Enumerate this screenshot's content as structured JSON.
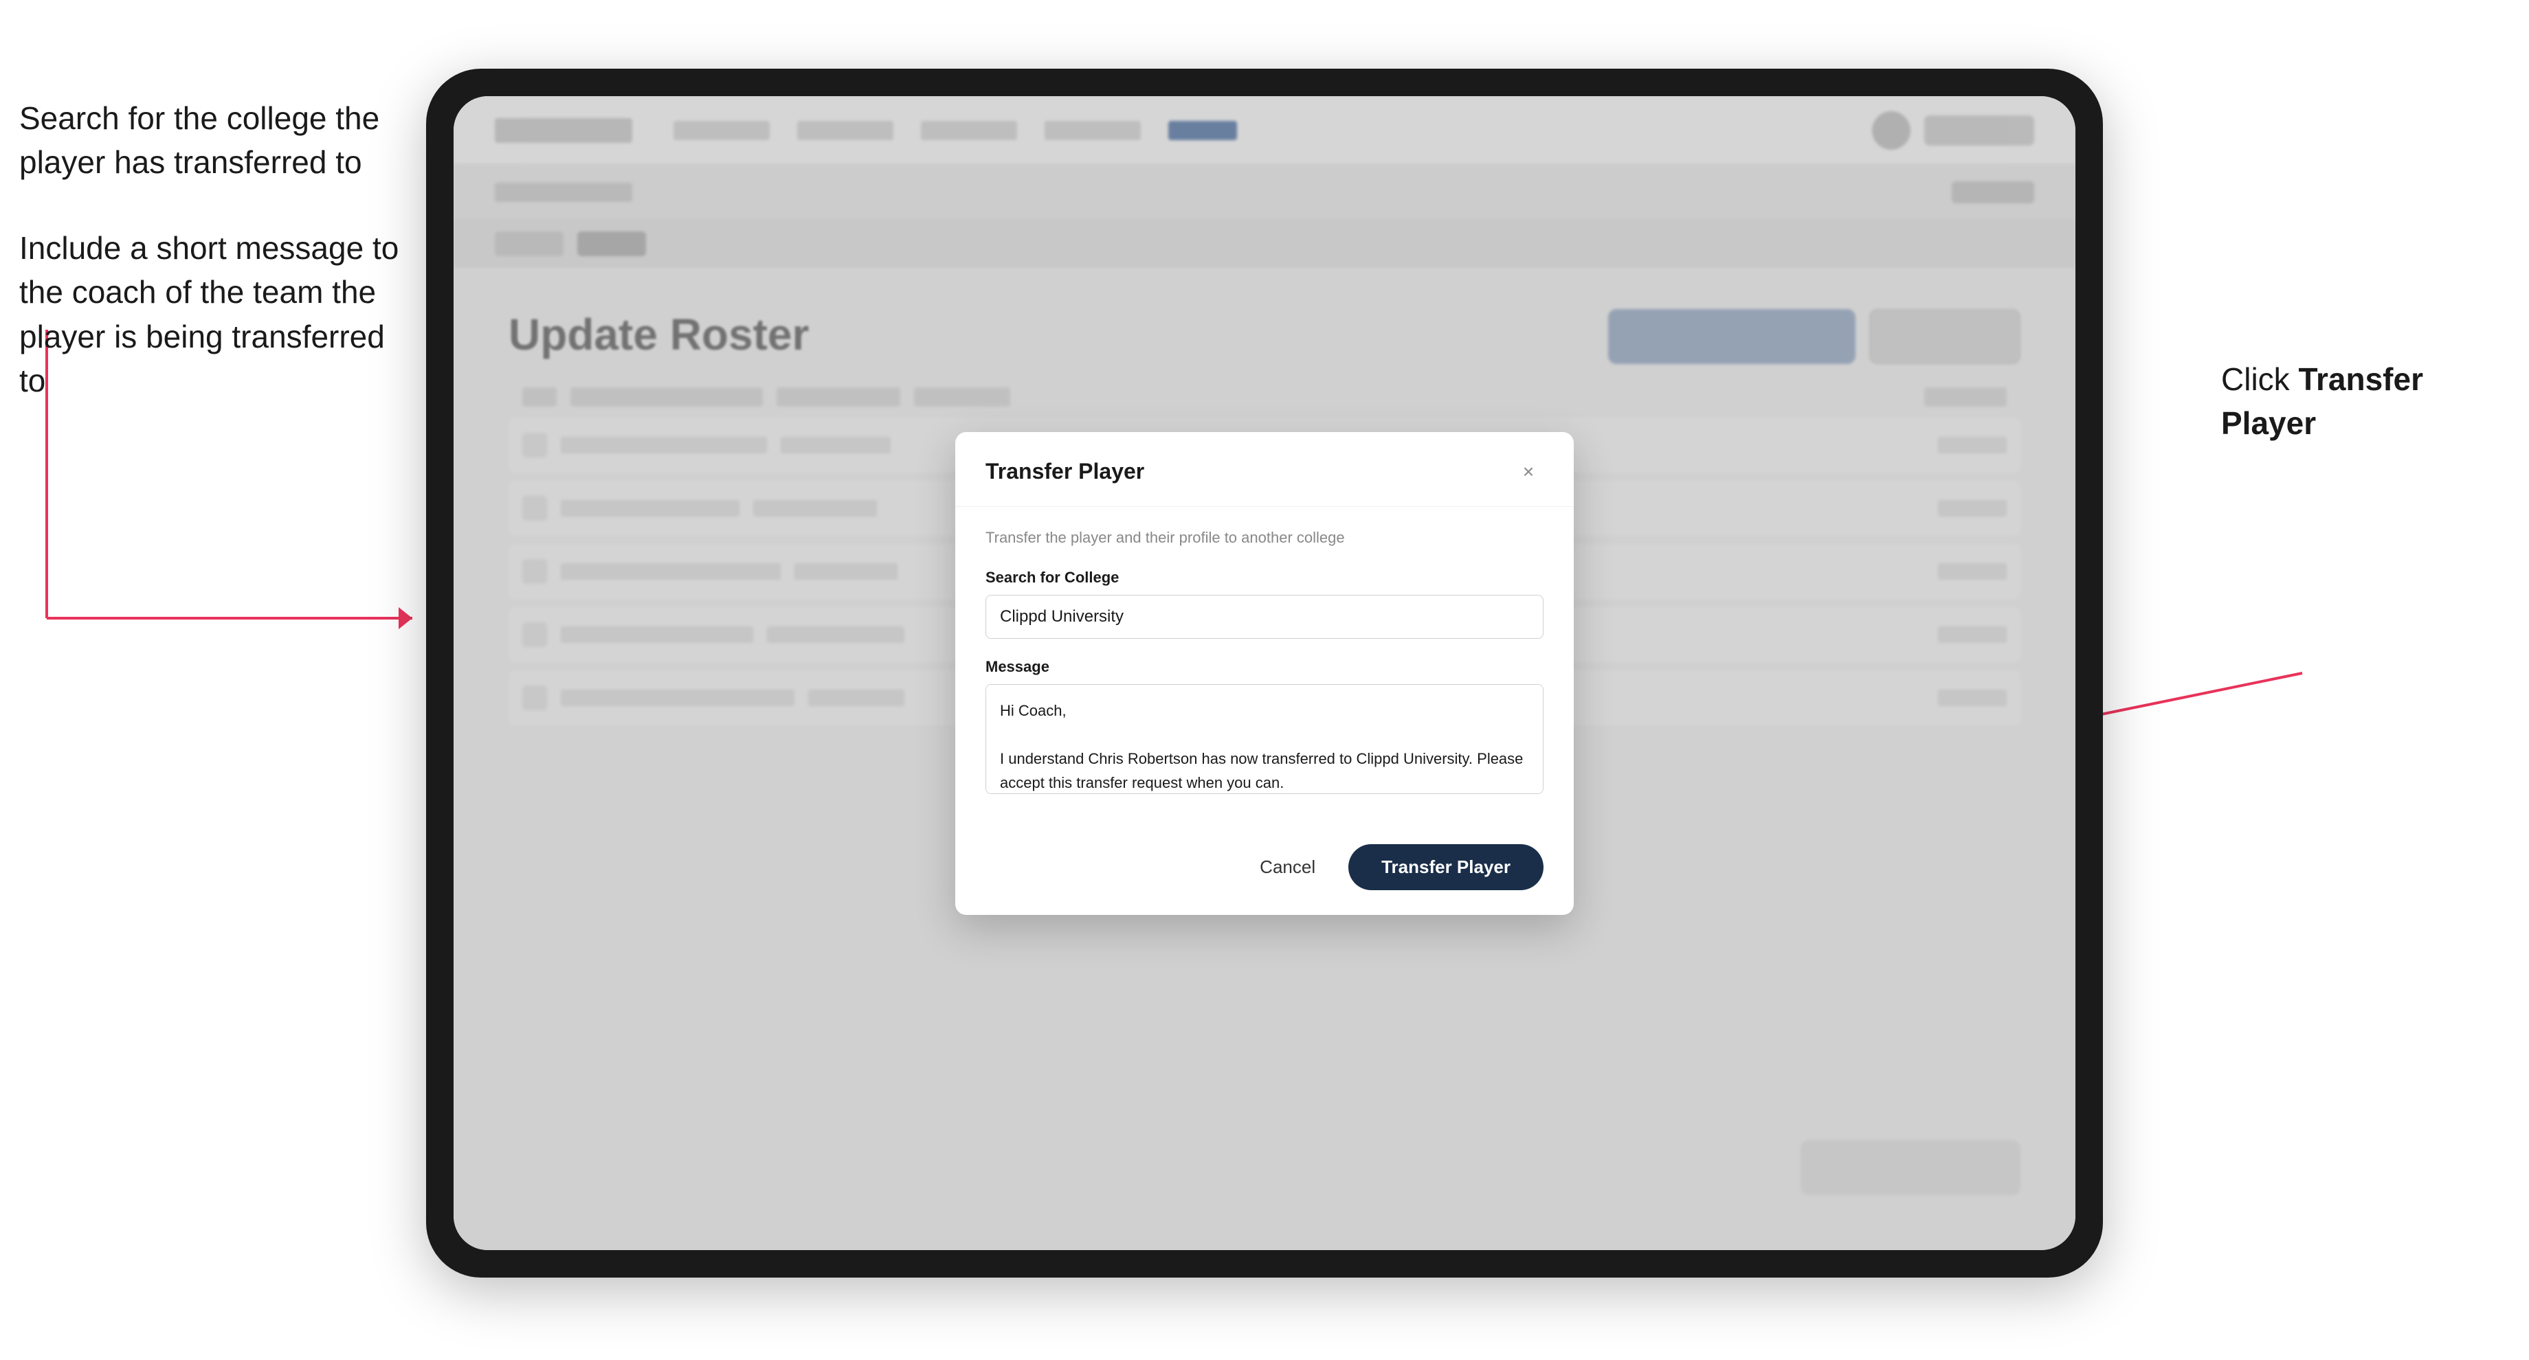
{
  "annotations": {
    "left_top": "Search for the college the player has transferred to",
    "left_bottom": "Include a short message to the coach of the team the player is being transferred to",
    "right": "Click Transfer Player"
  },
  "tablet": {
    "nav": {
      "logo_alt": "App Logo"
    },
    "page_title": "Update Roster"
  },
  "modal": {
    "title": "Transfer Player",
    "subtitle": "Transfer the player and their profile to another college",
    "search_label": "Search for College",
    "search_value": "Clippd University",
    "search_placeholder": "Search for College",
    "message_label": "Message",
    "message_value": "Hi Coach,\n\nI understand Chris Robertson has now transferred to Clippd University. Please accept this transfer request when you can.",
    "cancel_label": "Cancel",
    "transfer_label": "Transfer Player",
    "close_label": "×"
  }
}
